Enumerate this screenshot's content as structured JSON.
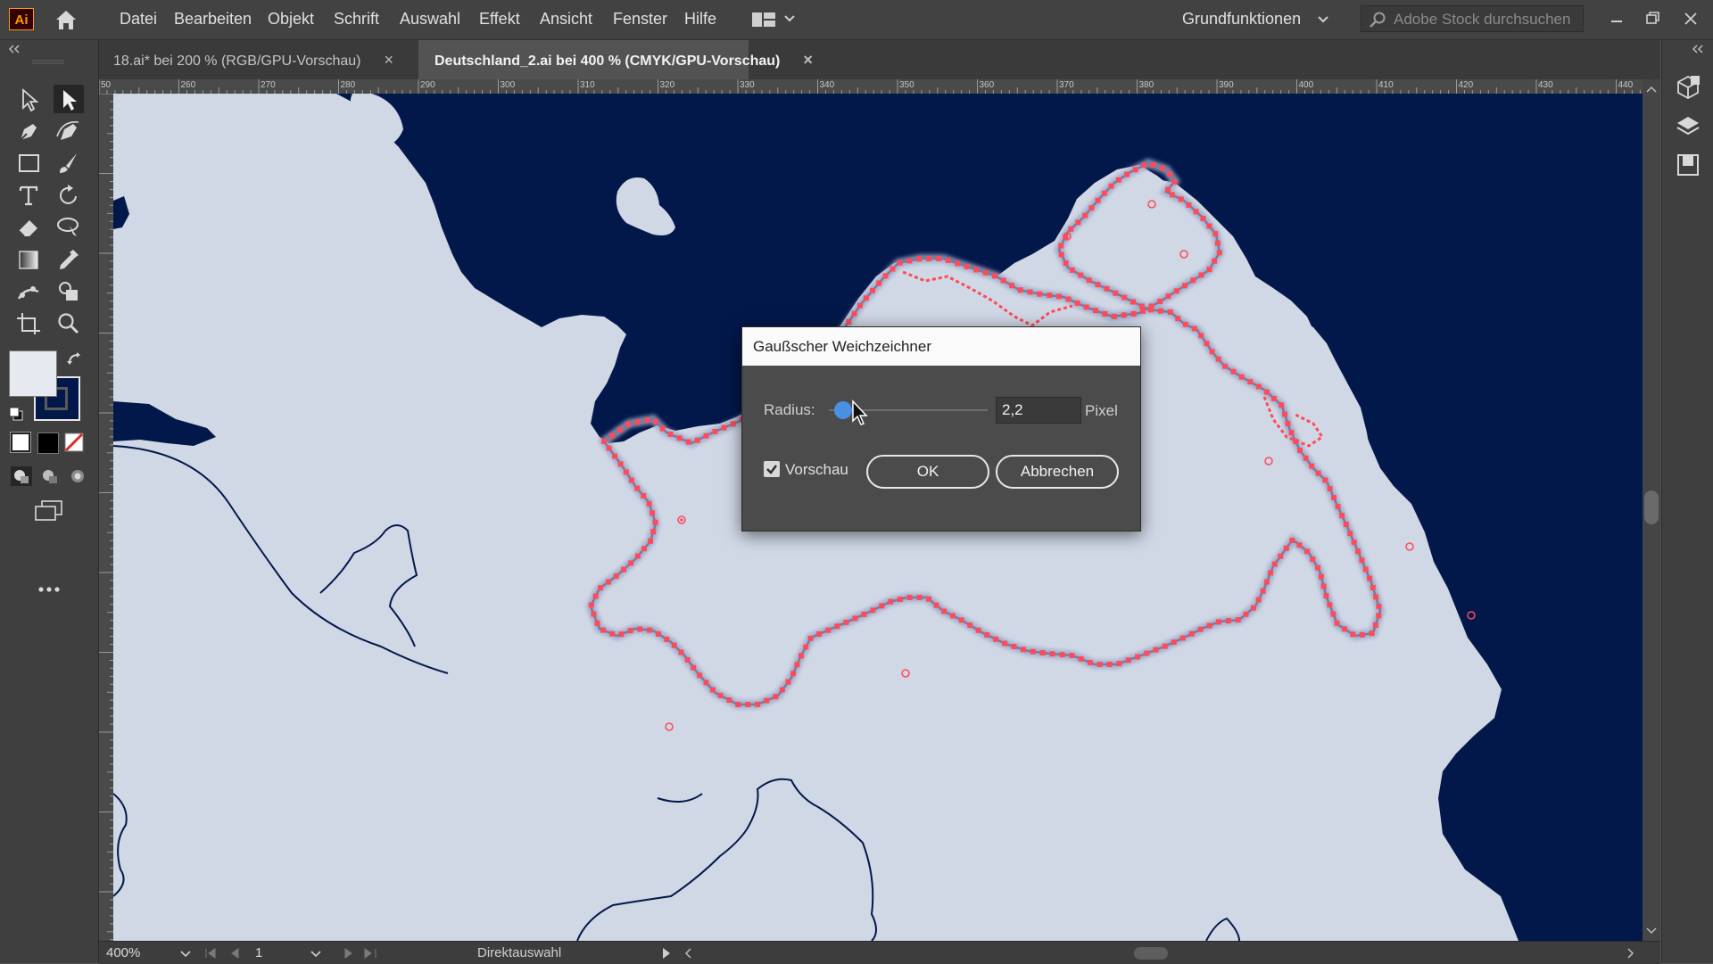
{
  "app": {
    "logo": "Ai"
  },
  "menu": {
    "items": [
      "Datei",
      "Bearbeiten",
      "Objekt",
      "Schrift",
      "Auswahl",
      "Effekt",
      "Ansicht",
      "Fenster",
      "Hilfe"
    ]
  },
  "workspace": {
    "label": "Grundfunktionen"
  },
  "search": {
    "placeholder": "Adobe Stock durchsuchen"
  },
  "tabs": [
    {
      "label": "18.ai* bei 200 % (RGB/GPU-Vorschau)",
      "close": "×"
    },
    {
      "label": "Deutschland_2.ai bei 400 % (CMYK/GPU-Vorschau)",
      "close": "×"
    }
  ],
  "ruler": {
    "top_labels": [
      "50",
      "260",
      "270",
      "280",
      "290",
      "300",
      "310",
      "320",
      "330",
      "340",
      "350",
      "360",
      "370",
      "380",
      "390",
      "400",
      "410",
      "420",
      "430",
      "440"
    ]
  },
  "dialog": {
    "title": "Gaußscher Weichzeichner",
    "radius_label": "Radius:",
    "radius_value": "2,2",
    "radius_unit": "Pixel",
    "preview_label": "Vorschau",
    "preview_checked": true,
    "ok_label": "OK",
    "cancel_label": "Abbrechen"
  },
  "status": {
    "zoom": "400%",
    "page": "1",
    "tool": "Direktauswahl"
  },
  "colors": {
    "sea": "#03184a",
    "land": "#d0d8e6",
    "selection": "#ff4a5a",
    "accent": "#4a90e2"
  }
}
